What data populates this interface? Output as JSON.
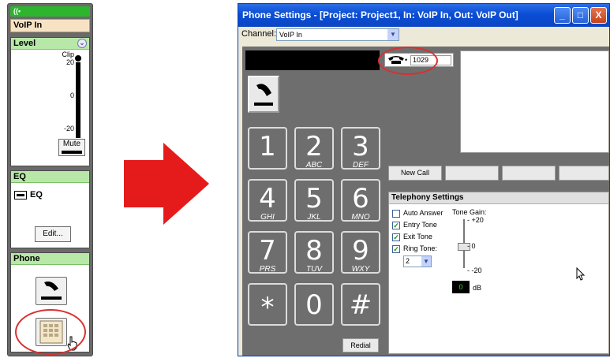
{
  "strip": {
    "top_glyph": "((•",
    "channel_name": "VoIP In",
    "level": {
      "title": "Level",
      "clip": "Clip",
      "scale": [
        "20",
        "0",
        "-20"
      ],
      "mute": "Mute"
    },
    "eq": {
      "title": "EQ",
      "toggle_label": "EQ",
      "edit": "Edit..."
    },
    "phone": {
      "title": "Phone"
    }
  },
  "window": {
    "title": "Phone Settings - [Project: Project1, In: VoIP In, Out: VoIP Out]",
    "controls": {
      "minimize": "_",
      "maximize": "□",
      "close": "X"
    },
    "channel_label": "Channel:",
    "channel_value": "VoIP In",
    "line_number": "1029",
    "keys": [
      {
        "d": "1",
        "l": ""
      },
      {
        "d": "2",
        "l": "ABC"
      },
      {
        "d": "3",
        "l": "DEF"
      },
      {
        "d": "4",
        "l": "GHI"
      },
      {
        "d": "5",
        "l": "JKL"
      },
      {
        "d": "6",
        "l": "MNO"
      },
      {
        "d": "7",
        "l": "PRS"
      },
      {
        "d": "8",
        "l": "TUV"
      },
      {
        "d": "9",
        "l": "WXY"
      },
      {
        "d": "*",
        "l": ""
      },
      {
        "d": "0",
        "l": ""
      },
      {
        "d": "#",
        "l": ""
      }
    ],
    "redial": "Redial",
    "new_call": "New Call",
    "telephony": {
      "title": "Telephony Settings",
      "auto_answer": "Auto Answer",
      "entry_tone": "Entry Tone",
      "exit_tone": "Exit Tone",
      "ring_tone": "Ring Tone:",
      "ring_value": "2",
      "tone_gain": "Tone Gain:",
      "gain_marks": [
        "+20",
        "0",
        "-20"
      ],
      "db_value": "0",
      "db_unit": "dB",
      "checks": {
        "auto_answer": false,
        "entry_tone": true,
        "exit_tone": true,
        "ring_tone": true
      }
    }
  },
  "colors": {
    "accent_red": "#e51b1b",
    "titlebar": "#0a4dd4",
    "panel_grey": "#6e6e6e",
    "strip_header_green": "#b8e8a8"
  }
}
